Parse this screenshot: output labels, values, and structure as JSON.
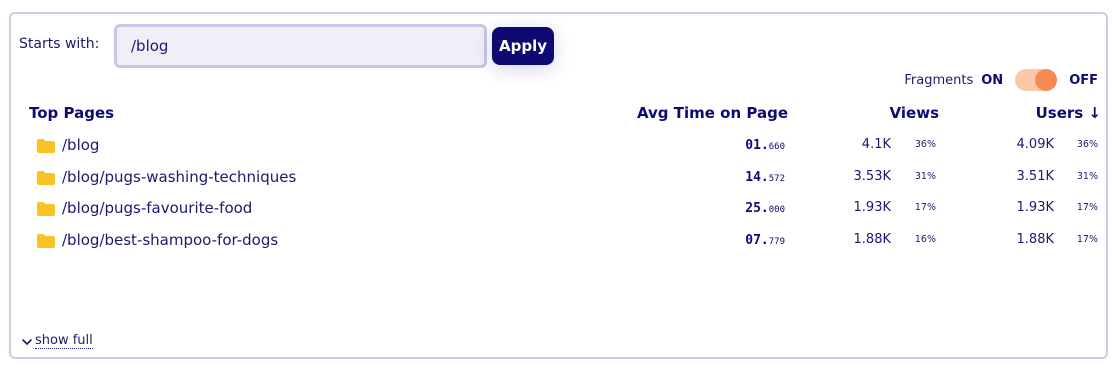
{
  "filter": {
    "label": "Starts with:",
    "value": "/blog",
    "apply_label": "Apply"
  },
  "fragments": {
    "label": "Fragments",
    "on_label": "ON",
    "off_label": "OFF",
    "state": "OFF"
  },
  "table": {
    "headers": {
      "page": "Top Pages",
      "time": "Avg Time on Page",
      "views": "Views",
      "users": "Users ↓"
    },
    "rows": [
      {
        "path": "/blog",
        "time_main": "01.",
        "time_frac": "660",
        "views": "4.1K",
        "views_pct": "36%",
        "users": "4.09K",
        "users_pct": "36%"
      },
      {
        "path": "/blog/pugs-washing-techniques",
        "time_main": "14.",
        "time_frac": "572",
        "views": "3.53K",
        "views_pct": "31%",
        "users": "3.51K",
        "users_pct": "31%"
      },
      {
        "path": "/blog/pugs-favourite-food",
        "time_main": "25.",
        "time_frac": "000",
        "views": "1.93K",
        "views_pct": "17%",
        "users": "1.93K",
        "users_pct": "17%"
      },
      {
        "path": "/blog/best-shampoo-for-dogs",
        "time_main": "07.",
        "time_frac": "779",
        "views": "1.88K",
        "views_pct": "16%",
        "users": "1.88K",
        "users_pct": "17%"
      }
    ]
  },
  "footer": {
    "show_full_label": "show full"
  },
  "colors": {
    "accent": "#0e0a72",
    "toggle_track": "#fbc9a9",
    "toggle_knob": "#f58a55",
    "folder": "#f9c423"
  },
  "icons": {
    "folder": "folder-icon",
    "chevron": "chevron-down-icon"
  }
}
